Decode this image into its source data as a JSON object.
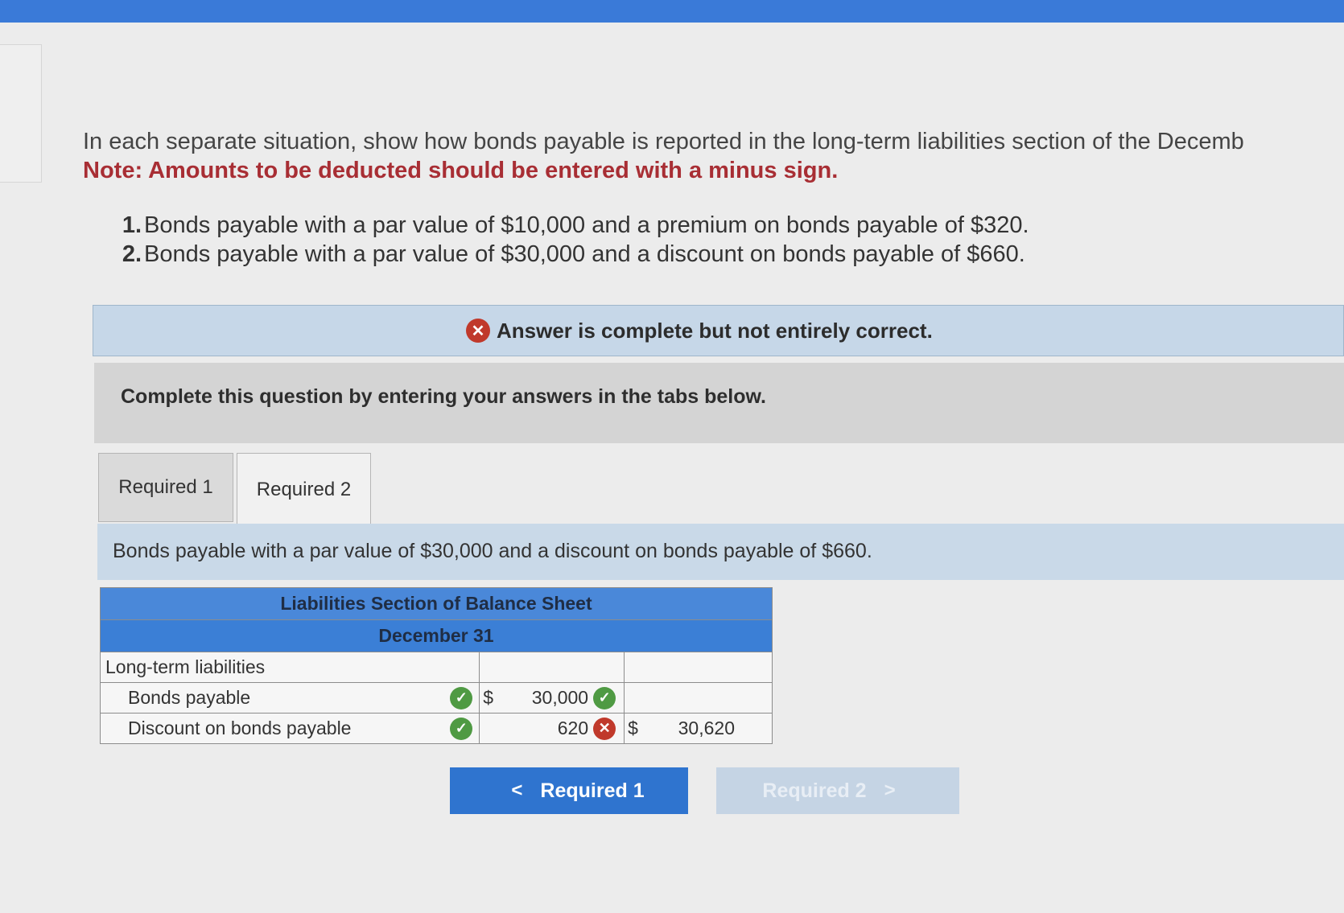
{
  "question": {
    "intro": "In each separate situation, show how bonds payable is reported in the long-term liabilities section of the Decemb",
    "note": "Note: Amounts to be deducted should be entered with a minus sign.",
    "situations": [
      {
        "num": "1.",
        "text": "Bonds payable with a par value of $10,000 and a premium on bonds payable of $320."
      },
      {
        "num": "2.",
        "text": "Bonds payable with a par value of $30,000 and a discount on bonds payable of $660."
      }
    ]
  },
  "feedback": {
    "icon": "x-circle-icon",
    "text": "Answer is complete but not entirely correct."
  },
  "instruction": "Complete this question by entering your answers in the tabs below.",
  "tabs": [
    {
      "label": "Required 1",
      "active": false
    },
    {
      "label": "Required 2",
      "active": true
    }
  ],
  "prompt": "Bonds payable with a par value of $30,000 and a discount on bonds payable of $660.",
  "table": {
    "title": "Liabilities Section of Balance Sheet",
    "subtitle": "December 31",
    "section_label": "Long-term liabilities",
    "rows": [
      {
        "label": "Bonds payable",
        "label_status": "correct",
        "currency": "$",
        "amount": "30,000",
        "amount_status": "correct",
        "total_currency": "",
        "total": ""
      },
      {
        "label": "Discount on bonds payable",
        "label_status": "correct",
        "currency": "",
        "amount": "620",
        "amount_status": "incorrect",
        "total_currency": "$",
        "total": "30,620"
      }
    ]
  },
  "nav": {
    "prev_label": "Required 1",
    "next_label": "Required 2"
  },
  "colors": {
    "top_bar": "#3a7ad8",
    "note_red": "#a82e34",
    "correct_green": "#4f9a43",
    "incorrect_red": "#c0392b",
    "header_blue": "#3b7fd6"
  }
}
